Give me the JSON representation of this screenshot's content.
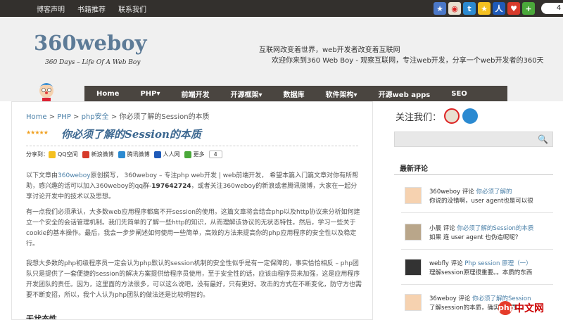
{
  "topnav": [
    "博客声明",
    "书籍推荐",
    "联系我们"
  ],
  "social": {
    "count": "4",
    "icons": [
      "star-icon",
      "weibo-icon",
      "tencent-weibo-icon",
      "qzone-icon",
      "renren-icon",
      "kaixin-icon",
      "plus-icon"
    ]
  },
  "header": {
    "logo": "360weboy",
    "tagline": "360 Days – Life Of A Web Boy",
    "slogan1": "互联网改变着世界，web开发者改变着互联网",
    "slogan2": "欢迎你来到360 Web Boy - 观察互联网，专注web开发，分享一个web开发者的360天"
  },
  "mainnav": [
    "Home",
    "PHP▾",
    "前端开发",
    "开源框架▾",
    "数据库",
    "软件架构▾",
    "开源web apps",
    "SEO"
  ],
  "breadcrumb": {
    "home": "Home",
    "sep1": " > ",
    "php": "PHP",
    "sep2": " > ",
    "security": "php安全",
    "sep3": " > ",
    "current": "你必须了解的Session的本质"
  },
  "post": {
    "stars": "★★★★★",
    "title": "你必须了解的Session的本质",
    "share_label": "分享到：",
    "share_items": [
      "QQ空间",
      "新浪微博",
      "腾讯微博",
      "人人网",
      "更多"
    ],
    "share_count": "4",
    "p1a": "以下文章由",
    "p1link": "360weboy",
    "p1b": "原创撰写， 360weboy – 专注php web开发 | web前端开发， 希望本篇入门篇文章对你有所帮助，感兴趣的话可以加入360weboy的qq群-",
    "p1qq": "197642724",
    "p1c": "，或者关注360weboy的新浪或者腾讯微博，大家在一起分享讨论开发中的技术以及思想。",
    "p2": "有一点我们必须承认，大多数web应用程序都离不开session的使用。这篇文章将会结合php以及http协议来分析如何建立一个安全的会话管理机制。我们先简单的了解一些http的知识，从而理解该协议的无状态特性。然后，学习一些关于cookie的基本操作。最后，我会一步步阐述如何使用一些简单，高效的方法来提高你的php应用程序的安全性以及稳定行。",
    "p3": "我想大多数的php初级程序员一定会认为php默认的session机制的安全性似乎是有一定保障的，事实恰恰相反 – php团队只是提供了一套便捷的session的解决方案提供给程序员使用，至于安全性的话，应该由程序员来加强，这是应用程序开发团队的责任。因为，这里面的方法很多，可以这么说吧，没有最好，只有更好。攻击的方式在不断变化，防守方也需要不断变招，所以，我个人认为php团队的做法还是比较明智的。",
    "h2": "无状态性"
  },
  "sidebar": {
    "follow": "关注我们：",
    "search_btn": "🔍",
    "recent_title": "最新评论",
    "comments": [
      {
        "name": "360weboy",
        "says": " 评论 ",
        "post": "你必须了解的",
        "text": "你说的没错啊，user agent也是可以很"
      },
      {
        "name": "小晨",
        "says": " 评论 ",
        "post": "你必须了解的Session的本质",
        "text": "如果 连 user agent 也伪造呢呢？"
      },
      {
        "name": "webfly",
        "says": " 评论 ",
        "post": "Php session 原理（一）",
        "text": "理解session原理很重要。。本质的东西"
      },
      {
        "name": "36weboy",
        "says": " 评论 ",
        "post": "你必须了解的Session",
        "text": "了解session的本质，确实很重要。。"
      }
    ]
  },
  "watermark": {
    "dot": "php",
    "text": "中文网"
  },
  "colors": {
    "accent": "#3b6790",
    "link": "#4b80a8",
    "nav_bg": "#4a4540",
    "topbar_bg": "#33302d"
  }
}
